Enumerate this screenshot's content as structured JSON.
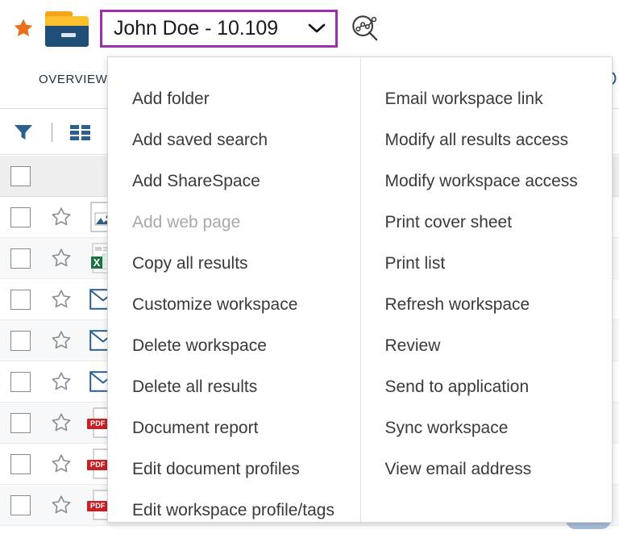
{
  "topbar": {
    "favorite_icon": "star-icon",
    "folder_icon": "folder-icon",
    "workspace_name": "John Doe - 10.109",
    "chevron_icon": "chevron-down-icon",
    "analytics_icon": "analytics-search-icon",
    "selector_border_color": "#9b2fae"
  },
  "tabs": [
    {
      "label": "OVERVIEW",
      "active": true
    }
  ],
  "toolbar": {
    "filter_icon": "filter-funnel-icon",
    "view_icon": "grid-view-icon",
    "accent_color": "#2b5f8e"
  },
  "list": {
    "header": {
      "select_all_checkbox": "select-all-checkbox"
    },
    "rows": [
      {
        "checkbox": "row-checkbox",
        "star": "star-outline-icon",
        "type": "image-file-icon",
        "alt": false
      },
      {
        "checkbox": "row-checkbox",
        "star": "star-outline-icon",
        "type": "excel-file-icon",
        "alt": true
      },
      {
        "checkbox": "row-checkbox",
        "star": "star-outline-icon",
        "type": "email-icon",
        "alt": false
      },
      {
        "checkbox": "row-checkbox",
        "star": "star-outline-icon",
        "type": "email-icon",
        "alt": true
      },
      {
        "checkbox": "row-checkbox",
        "star": "star-outline-icon",
        "type": "email-icon",
        "alt": false
      },
      {
        "checkbox": "row-checkbox",
        "star": "star-outline-icon",
        "type": "pdf-file-icon",
        "badge": "PDF",
        "alt": true
      },
      {
        "checkbox": "row-checkbox",
        "star": "star-outline-icon",
        "type": "pdf-file-icon",
        "badge": "PDF",
        "alt": false
      },
      {
        "checkbox": "row-checkbox",
        "star": "star-outline-icon",
        "type": "pdf-file-icon",
        "badge": "PDF",
        "alt": true
      }
    ]
  },
  "menu": {
    "left_column": [
      {
        "label": "Add folder",
        "disabled": false
      },
      {
        "label": "Add saved search",
        "disabled": false
      },
      {
        "label": "Add ShareSpace",
        "disabled": false
      },
      {
        "label": "Add web page",
        "disabled": true
      },
      {
        "label": "Copy all results",
        "disabled": false
      },
      {
        "label": "Customize workspace",
        "disabled": false
      },
      {
        "label": "Delete workspace",
        "disabled": false
      },
      {
        "label": "Delete all results",
        "disabled": false
      },
      {
        "label": "Document report",
        "disabled": false
      },
      {
        "label": "Edit document profiles",
        "disabled": false
      },
      {
        "label": "Edit workspace profile/tags",
        "disabled": false
      }
    ],
    "right_column": [
      {
        "label": "Email workspace link",
        "disabled": false
      },
      {
        "label": "Modify all results access",
        "disabled": false
      },
      {
        "label": "Modify workspace access",
        "disabled": false
      },
      {
        "label": "Print cover sheet",
        "disabled": false
      },
      {
        "label": "Print list",
        "disabled": false
      },
      {
        "label": "Refresh workspace",
        "disabled": false
      },
      {
        "label": "Review",
        "disabled": false
      },
      {
        "label": "Send to application",
        "disabled": false
      },
      {
        "label": "Sync workspace",
        "disabled": false
      },
      {
        "label": "View email address",
        "disabled": false
      }
    ]
  }
}
